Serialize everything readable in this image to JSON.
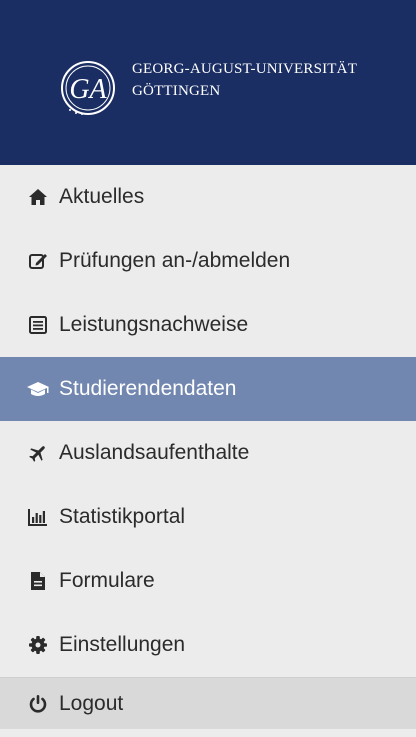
{
  "header": {
    "university_line1": "GEORG-AUGUST-UNIVERSITÄT",
    "university_line2": "GÖTTINGEN",
    "logo_letters": "GA",
    "background_color": "#1a2e63"
  },
  "nav": {
    "items": [
      {
        "label": "Aktuelles",
        "icon": "home-icon"
      },
      {
        "label": "Prüfungen an-/abmelden",
        "icon": "edit-icon"
      },
      {
        "label": "Leistungsnachweise",
        "icon": "list-icon"
      },
      {
        "label": "Studierendendaten",
        "icon": "graduation-cap-icon",
        "active": true
      },
      {
        "label": "Auslandsaufenthalte",
        "icon": "plane-icon"
      },
      {
        "label": "Statistikportal",
        "icon": "bar-chart-icon"
      },
      {
        "label": "Formulare",
        "icon": "document-icon"
      },
      {
        "label": "Einstellungen",
        "icon": "gear-icon"
      }
    ],
    "logout": {
      "label": "Logout",
      "icon": "power-icon"
    },
    "active_color": "#7287b0"
  }
}
